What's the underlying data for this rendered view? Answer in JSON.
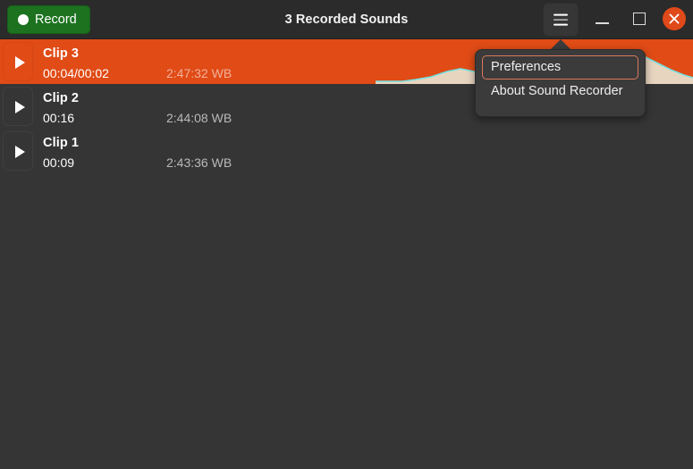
{
  "window": {
    "title": "3 Recorded Sounds"
  },
  "header": {
    "record_label": "Record",
    "record_icon": "record-dot-icon",
    "menu_icon": "hamburger-menu-icon",
    "minimize_icon": "minimize-icon",
    "maximize_icon": "maximize-icon",
    "close_icon": "close-icon",
    "accent_green": "#1c721f",
    "close_color": "#e0491a"
  },
  "clips": [
    {
      "title": "Clip 3",
      "duration": "00:04/00:02",
      "timestamp": "2:47:32 WB",
      "selected": true,
      "play_icon": "play-icon"
    },
    {
      "title": "Clip 2",
      "duration": "00:16",
      "timestamp": "2:44:08 WB",
      "selected": false,
      "play_icon": "play-icon"
    },
    {
      "title": "Clip 1",
      "duration": "00:09",
      "timestamp": "2:43:36 WB",
      "selected": false,
      "play_icon": "play-icon"
    }
  ],
  "popover": {
    "items": [
      {
        "label": "Preferences",
        "focused": true
      },
      {
        "label": "About Sound Recorder",
        "focused": false
      }
    ],
    "focus_ring_color": "#d8795c"
  },
  "colors": {
    "selection_orange": "#e04b16",
    "body_background": "#353535",
    "headerbar_background": "#2b2b2b",
    "waveform_fill": "#e8d5c0",
    "waveform_edge": "#76e0e0"
  }
}
